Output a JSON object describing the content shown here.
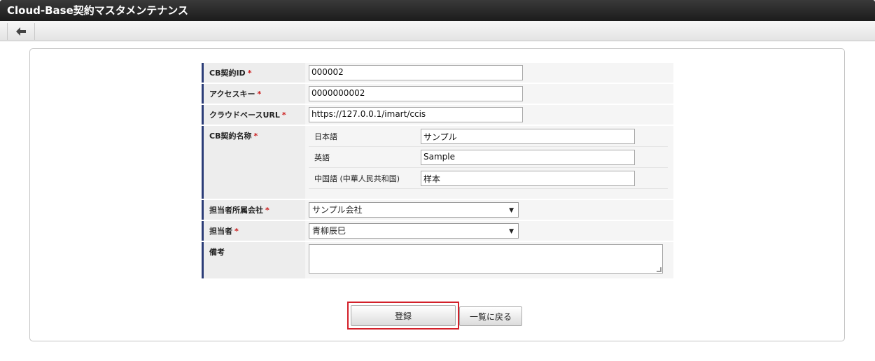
{
  "window": {
    "title": "Cloud-Base契約マスタメンテナンス"
  },
  "toolbar": {
    "back_icon": "arrow-left-icon"
  },
  "form": {
    "cb_id": {
      "label": "CB契約ID",
      "required_mark": "*",
      "value": "000002"
    },
    "access_key": {
      "label": "アクセスキー",
      "required_mark": "*",
      "value": "0000000002"
    },
    "cloud_url": {
      "label": "クラウドベースURL",
      "required_mark": "*",
      "value": "https://127.0.0.1/imart/ccis"
    },
    "cb_name": {
      "label": "CB契約名称",
      "required_mark": "*",
      "locales": [
        {
          "label": "日本語",
          "value": "サンプル"
        },
        {
          "label": "英語",
          "value": "Sample"
        },
        {
          "label": "中国語 (中華人民共和国)",
          "value": "样本"
        }
      ]
    },
    "company": {
      "label": "担当者所属会社",
      "required_mark": "*",
      "value": "サンプル会社"
    },
    "person": {
      "label": "担当者",
      "required_mark": "*",
      "value": "青柳辰巳"
    },
    "notes": {
      "label": "備考",
      "value": ""
    }
  },
  "actions": {
    "register": "登録",
    "back_to_list": "一覧に戻る"
  }
}
